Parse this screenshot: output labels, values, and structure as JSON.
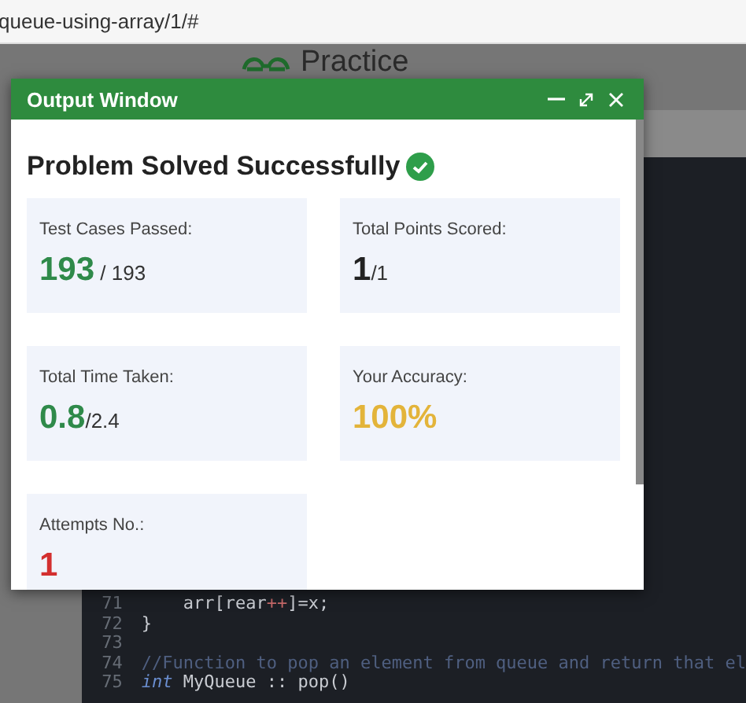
{
  "address_bar": {
    "url": "queue-using-array/1/#"
  },
  "logo": {
    "text": "Practice"
  },
  "output_window": {
    "title": "Output Window",
    "heading": "Problem Solved Successfully",
    "cards": [
      {
        "label": "Test Cases Passed:",
        "value": "193",
        "total": " / 193",
        "color": "#2f8a4a"
      },
      {
        "label": "Total Points Scored:",
        "value": "1",
        "total": "/1",
        "color": "#222222"
      },
      {
        "label": "Total Time Taken:",
        "value": "0.8",
        "total": "/2.4",
        "color": "#2f8a4a"
      },
      {
        "label": "Your Accuracy:",
        "value": "100%",
        "color": "#e3b43a"
      },
      {
        "label": "Attempts No.:",
        "value": "1",
        "color": "#d32f2f"
      }
    ]
  },
  "editor": {
    "lines": [
      {
        "number": "71",
        "tokens": [
          {
            "text": "    arr[rear",
            "kind": "plain"
          },
          {
            "text": "++",
            "kind": "operator"
          },
          {
            "text": "]=x;",
            "kind": "plain"
          }
        ]
      },
      {
        "number": "72",
        "tokens": [
          {
            "text": "}",
            "kind": "plain"
          }
        ]
      },
      {
        "number": "73"
      },
      {
        "number": "74",
        "tokens": [
          {
            "text": "//Function to pop an element from queue and return that el",
            "kind": "comment"
          }
        ]
      },
      {
        "number": "75",
        "tokens": [
          {
            "text": "int",
            "kind": "keyword"
          },
          {
            "text": " MyQueue :: pop()",
            "kind": "plain"
          }
        ]
      }
    ]
  }
}
